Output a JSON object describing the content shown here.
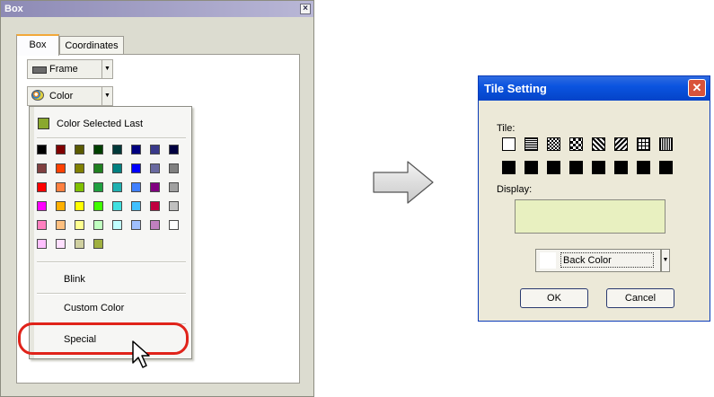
{
  "box_window": {
    "title": "Box",
    "tabs": [
      "Box",
      "Coordinates"
    ],
    "frame_label": "Frame",
    "color_label": "Color"
  },
  "color_menu": {
    "last_label": "Color Selected Last",
    "last_color": "#8aa82e",
    "swatches": [
      [
        "#000000",
        "#800000",
        "#5a5a00",
        "#004000",
        "#003838",
        "#000080",
        "#3a3a8a",
        "#000040"
      ],
      [
        "#804040",
        "#ff4000",
        "#808000",
        "#208020",
        "#008080",
        "#0000ff",
        "#6a6aa0",
        "#808080"
      ],
      [
        "#ff0000",
        "#ff8040",
        "#80c000",
        "#20a040",
        "#20b0b0",
        "#4080ff",
        "#800080",
        "#a0a0a0"
      ],
      [
        "#ff00ff",
        "#ffb000",
        "#ffff00",
        "#40ff00",
        "#40e0e0",
        "#40c0ff",
        "#c00040",
        "#c0c0c0"
      ],
      [
        "#ff80c0",
        "#ffc080",
        "#ffff90",
        "#c0ffc0",
        "#c0ffff",
        "#a0c0ff",
        "#c080c0",
        "#ffffff"
      ],
      [
        "#ffc0ff",
        "#ffe0ff",
        "#d0d0a0",
        "#a0b040"
      ]
    ],
    "blink_label": "Blink",
    "custom_label": "Custom Color",
    "special_label": "Special"
  },
  "tile_dialog": {
    "title": "Tile Setting",
    "tile_label": "Tile:",
    "display_label": "Display:",
    "display_color": "#e8f0c0",
    "back_color_label": "Back Color",
    "ok_label": "OK",
    "cancel_label": "Cancel"
  }
}
